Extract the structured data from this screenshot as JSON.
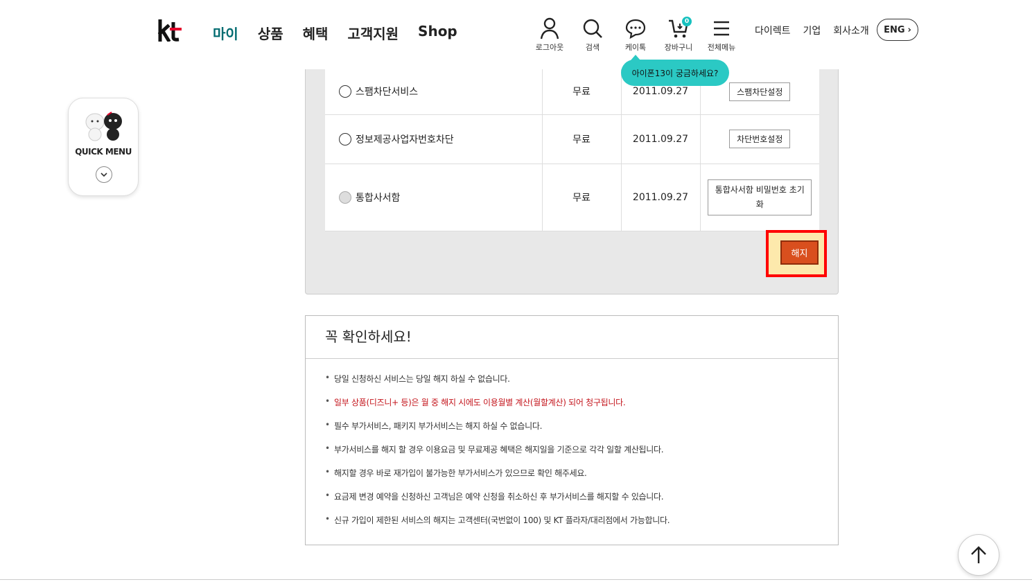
{
  "header": {
    "logo": "kt",
    "gnb": [
      "마이",
      "상품",
      "혜택",
      "고객지원",
      "Shop"
    ],
    "utils": [
      "로그아웃",
      "검색",
      "케이톡",
      "장바구니",
      "전체메뉴"
    ],
    "cart_count": "0",
    "links": [
      "다이렉트",
      "기업",
      "회사소개"
    ],
    "eng": "ENG"
  },
  "bubble": "아이폰13이 궁금하세요?",
  "quick_menu": {
    "title": "QUICK MENU"
  },
  "services": [
    {
      "name": "스팸차단서비스",
      "fee": "무료",
      "date": "2011.09.27",
      "action": "스팸차단설정"
    },
    {
      "name": "정보제공사업자번호차단",
      "fee": "무료",
      "date": "2011.09.27",
      "action": "차단번호설정"
    },
    {
      "name": "통합사서함",
      "fee": "무료",
      "date": "2011.09.27",
      "action": "통합사서함 비밀번호 초기화"
    }
  ],
  "cancel_button": "해지",
  "notice": {
    "title": "꼭 확인하세요!",
    "items": [
      "당일 신청하신 서비스는 당일 해지 하실 수 없습니다.",
      "일부 상품(디즈니+ 등)은 월 중 해지 시에도 이용월별 계산(월할계산) 되어 청구됩니다.",
      "필수 부가서비스, 패키지 부가서비스는 해지 하실 수 없습니다.",
      "부가서비스를 해지 할 경우 이용요금 및 무료제공 혜택은 해지일을 기준으로 각각 일할 계산됩니다.",
      "해지할 경우 바로 재가입이 불가능한 부가서비스가 있으므로 확인 해주세요.",
      "요금제 변경 예약을 신청하신 고객님은 예약 신청을 취소하신 후 부가서비스를 해지할 수 있습니다.",
      "신규 가입이 제한된 서비스의 해지는 고객센터(국번없이 100) 및 KT 플라자/대리점에서 가능합니다."
    ]
  },
  "colors": {
    "active_nav": "#006b70",
    "accent": "#2bc9c4",
    "cancel": "#d94f1e",
    "warning_text": "#c4151c"
  }
}
